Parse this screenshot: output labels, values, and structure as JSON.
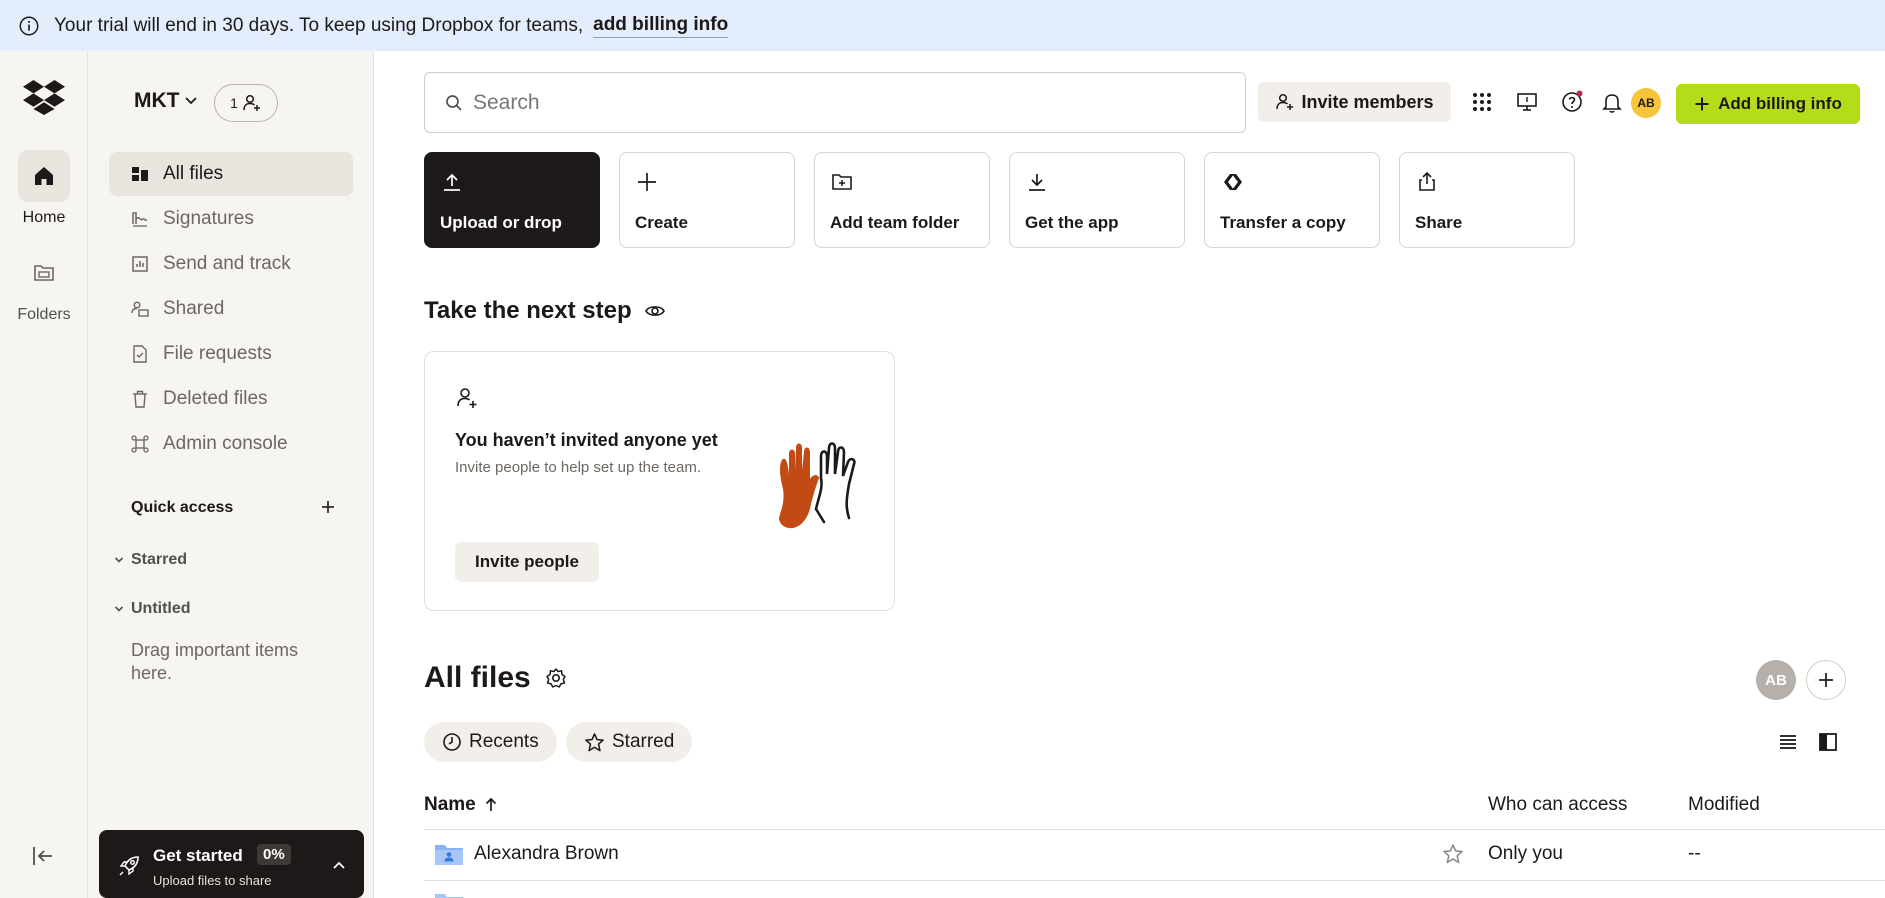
{
  "banner": {
    "message": "Your trial will end in 30 days. To keep using Dropbox for teams,",
    "link": "add billing info",
    "icon": "info-icon"
  },
  "rail": {
    "home_label": "Home",
    "folders_label": "Folders"
  },
  "sidebar": {
    "team_name": "MKT",
    "member_count": "1",
    "items": [
      {
        "label": "All files",
        "icon": "all-files-icon",
        "active": true
      },
      {
        "label": "Signatures",
        "icon": "signature-icon"
      },
      {
        "label": "Send and track",
        "icon": "chart-icon"
      },
      {
        "label": "Shared",
        "icon": "shared-icon"
      },
      {
        "label": "File requests",
        "icon": "file-request-icon"
      },
      {
        "label": "Deleted files",
        "icon": "trash-icon"
      },
      {
        "label": "Admin console",
        "icon": "admin-icon"
      }
    ],
    "quick_access": {
      "title": "Quick access",
      "sections": [
        "Starred",
        "Untitled"
      ],
      "empty_text": "Drag important items here."
    },
    "get_started": {
      "title": "Get started",
      "percent": "0%",
      "subtitle": "Upload files to share"
    }
  },
  "header": {
    "search_placeholder": "Search",
    "invite_label": "Invite members",
    "avatar_initials": "AB",
    "billing_label": "Add billing info"
  },
  "actions": [
    "Upload or drop",
    "Create",
    "Add team folder",
    "Get the app",
    "Transfer a copy",
    "Share"
  ],
  "next_step": {
    "title": "Take the next step",
    "card_title": "You haven’t invited anyone yet",
    "card_subtitle": "Invite people to help set up the team.",
    "card_button": "Invite people"
  },
  "files": {
    "title": "All files",
    "share_avatar": "AB",
    "chips": [
      "Recents",
      "Starred"
    ],
    "columns": {
      "name": "Name",
      "access": "Who can access",
      "modified": "Modified"
    },
    "rows": [
      {
        "name": "Alexandra Brown",
        "access": "Only you",
        "modified": "--"
      }
    ]
  },
  "colors": {
    "banner_bg": "#e3edfc",
    "billing_button": "#b4dc19",
    "avatar_yellow": "#f7c53b",
    "dark": "#1e1919"
  }
}
